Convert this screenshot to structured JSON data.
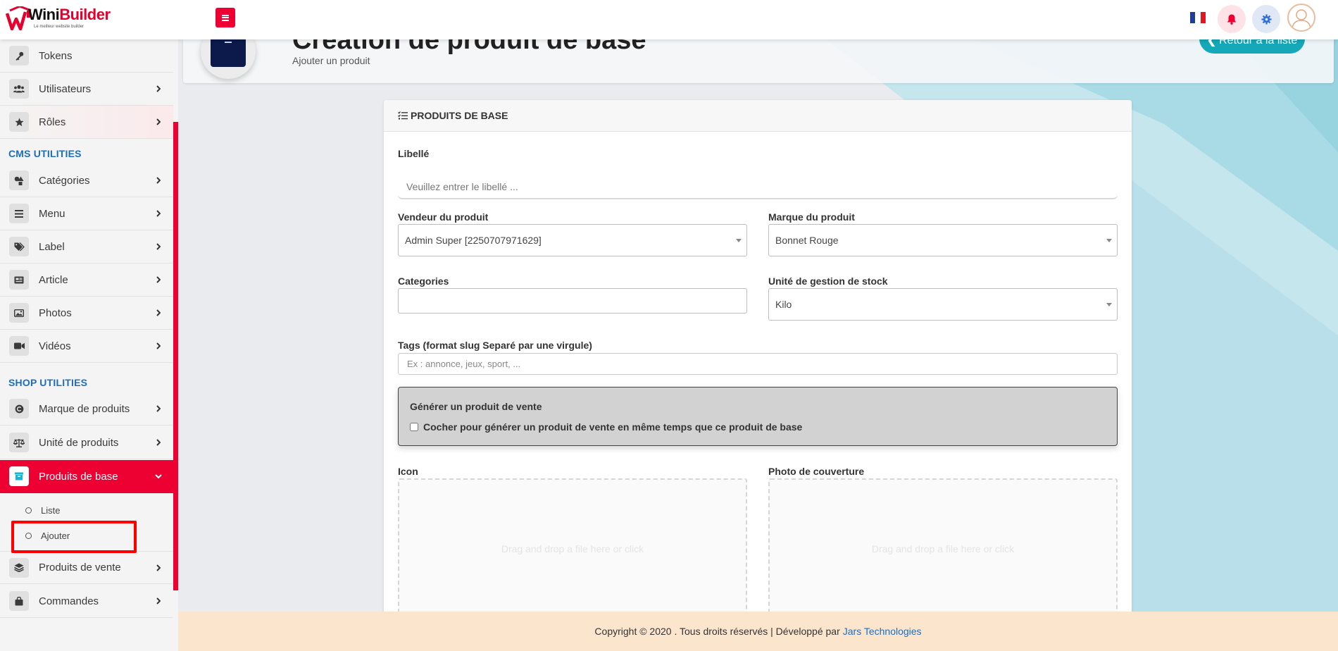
{
  "brand": {
    "name_part1": "Wini",
    "name_part2": "Builder",
    "tagline": "Le meilleur website builder"
  },
  "topbar": {
    "menu_icon": "hamburger-icon",
    "flag_icon": "france-flag-icon",
    "bell_icon": "bell-icon",
    "gear_icon": "gear-icon",
    "avatar_icon": "user-avatar-icon",
    "accent_color": "#ed0032"
  },
  "sidebar": {
    "items_top": [
      {
        "label": "Tokens",
        "icon": "key-icon"
      },
      {
        "label": "Utilisateurs",
        "icon": "users-icon"
      },
      {
        "label": "Rôles",
        "icon": "star-icon"
      }
    ],
    "cms_title": "CMS UTILITIES",
    "cms_items": [
      {
        "label": "Catégories",
        "icon": "shapes-icon"
      },
      {
        "label": "Menu",
        "icon": "bars-icon"
      },
      {
        "label": "Label",
        "icon": "tags-icon"
      },
      {
        "label": "Article",
        "icon": "newspaper-icon"
      },
      {
        "label": "Photos",
        "icon": "image-icon"
      },
      {
        "label": "Vidéos",
        "icon": "video-icon"
      }
    ],
    "shop_title": "SHOP UTILITIES",
    "shop_items": [
      {
        "label": "Marque de produits",
        "icon": "copyright-icon"
      },
      {
        "label": "Unité de produits",
        "icon": "balance-scale-icon"
      },
      {
        "label": "Produits de base",
        "icon": "archive-icon"
      }
    ],
    "sub_items": [
      {
        "label": "Liste"
      },
      {
        "label": "Ajouter"
      }
    ],
    "items_bottom": [
      {
        "label": "Produits de vente",
        "icon": "layers-icon"
      },
      {
        "label": "Commandes",
        "icon": "shopping-bag-icon"
      }
    ]
  },
  "header": {
    "title": "Création de produit de base",
    "subtitle": "Ajouter un produit",
    "back_label": "Retour à la liste"
  },
  "form": {
    "card_title": "PRODUITS DE BASE",
    "libelle_label": "Libellé",
    "libelle_placeholder": "Veuillez entrer le libellé ...",
    "vendeur_label": "Vendeur du produit",
    "vendeur_value": "Admin Super [2250707971629]",
    "marque_label": "Marque du produit",
    "marque_value": "Bonnet Rouge",
    "categories_label": "Categories",
    "unite_label": "Unité de gestion de stock",
    "unite_value": "Kilo",
    "tags_label": "Tags (format slug Separé par une virgule)",
    "tags_placeholder": "Ex : annonce, jeux, sport, ...",
    "generate_title": "Générer un produit de vente",
    "generate_checkbox_label": "Cocher pour générer un produit de vente en même temps que ce produit de base",
    "icon_label": "Icon",
    "cover_label": "Photo de couverture",
    "dropzone_text": "Drag and drop a file here or click"
  },
  "footer": {
    "text": "Copyright © 2020 . Tous droits réservés | Développé par",
    "link": "Jars Technologies"
  }
}
